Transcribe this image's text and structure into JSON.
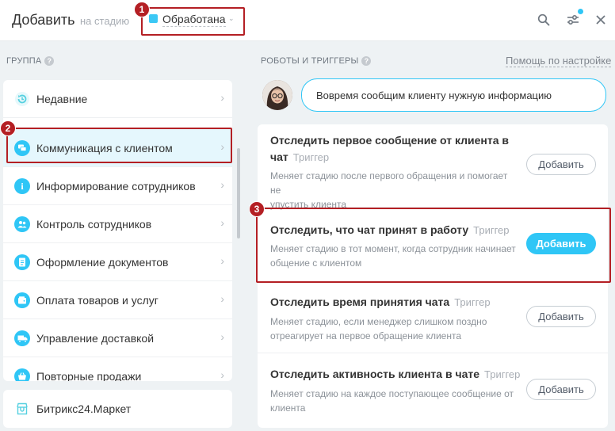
{
  "header": {
    "title": "Добавить",
    "stage_prefix": "на стадию",
    "stage_name": "Обработана",
    "colors": {
      "stage_dot": "#3bc8f5",
      "accent": "#2fc6f6",
      "marker": "#b41f24",
      "notify_dot": "#2fc6f6"
    },
    "icons": [
      "search-icon",
      "filter-settings-icon",
      "close-icon"
    ]
  },
  "markers": [
    "1",
    "2",
    "3"
  ],
  "left": {
    "section_label": "ГРУППА",
    "groups": [
      {
        "label": "Недавние",
        "icon": "recent-icon",
        "icon_color": "#55d0e0"
      },
      {
        "label": "Коммуникация с клиентом",
        "icon": "chat-icon",
        "icon_color": "#2fc6f6"
      },
      {
        "label": "Информирование сотрудников",
        "icon": "info-icon",
        "icon_color": "#2fc6f6"
      },
      {
        "label": "Контроль сотрудников",
        "icon": "users-icon",
        "icon_color": "#2fc6f6"
      },
      {
        "label": "Оформление документов",
        "icon": "document-icon",
        "icon_color": "#2fc6f6"
      },
      {
        "label": "Оплата товаров и услуг",
        "icon": "wallet-icon",
        "icon_color": "#2fc6f6"
      },
      {
        "label": "Управление доставкой",
        "icon": "truck-icon",
        "icon_color": "#2fc6f6"
      },
      {
        "label": "Повторные продажи",
        "icon": "basket-icon",
        "icon_color": "#2fc6f6"
      }
    ],
    "active_index": 1,
    "market": {
      "label": "Битрикс24.Маркет",
      "icon": "market-icon"
    }
  },
  "right": {
    "section_label": "РОБОТЫ И ТРИГГЕРЫ",
    "help_link": "Помощь по настройке",
    "assistant_message": "Вовремя сообщим клиенту нужную информацию",
    "cards": [
      {
        "title_line1": "Отследить первое сообщение от клиента в",
        "title_line2": "чат",
        "tag": "Триггер",
        "desc_line1": "Меняет стадию после первого обращения и помогает не",
        "desc_line2": "упустить клиента",
        "button": "Добавить",
        "primary": false
      },
      {
        "title_line1": "Отследить, что чат принят в работу",
        "tag": "Триггер",
        "desc_line1": "Меняет стадию в тот момент, когда сотрудник начинает",
        "desc_line2": "общение с клиентом",
        "button": "Добавить",
        "primary": true
      },
      {
        "title_line1": "Отследить время принятия чата",
        "tag": "Триггер",
        "desc_line1": "Меняет стадию, если менеджер слишком поздно",
        "desc_line2": "отреагирует на первое обращение клиента",
        "button": "Добавить",
        "primary": false
      },
      {
        "title_line1": "Отследить активность клиента в чате",
        "tag": "Триггер",
        "desc_line1": "Меняет стадию на каждое поступающее сообщение от",
        "desc_line2": "клиента",
        "button": "Добавить",
        "primary": false
      }
    ]
  }
}
